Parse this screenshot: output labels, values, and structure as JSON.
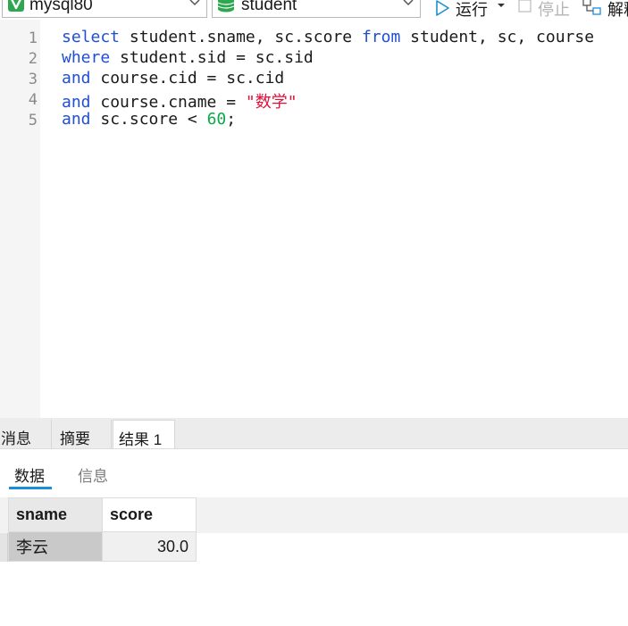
{
  "toolbar": {
    "connection": "mysql80",
    "database": "student",
    "run_label": "运行",
    "stop_label": "停止",
    "explain_label": "解释",
    "icons": [
      "connection-icon",
      "database-icon",
      "run-icon",
      "stop-icon",
      "explain-icon",
      "chevron-down-icon"
    ]
  },
  "editor": {
    "line_numbers": [
      "1",
      "2",
      "3",
      "4",
      "5"
    ],
    "lines": [
      [
        {
          "t": "select",
          "k": "kw"
        },
        {
          "t": " student.sname, sc.score ",
          "k": ""
        },
        {
          "t": "from",
          "k": "kw"
        },
        {
          "t": " student, sc, course",
          "k": ""
        }
      ],
      [
        {
          "t": "where",
          "k": "kw"
        },
        {
          "t": " student.sid = sc.sid",
          "k": ""
        }
      ],
      [
        {
          "t": "and",
          "k": "kw"
        },
        {
          "t": " course.cid = sc.cid",
          "k": ""
        }
      ],
      [
        {
          "t": "and",
          "k": "kw"
        },
        {
          "t": " course.cname = ",
          "k": ""
        },
        {
          "t": "\"数学\"",
          "k": "str"
        }
      ],
      [
        {
          "t": "and",
          "k": "kw"
        },
        {
          "t": " sc.score < ",
          "k": ""
        },
        {
          "t": "60",
          "k": "num"
        },
        {
          "t": ";",
          "k": ""
        }
      ]
    ]
  },
  "result_panel": {
    "tabs": [
      "消息",
      "摘要",
      "结果 1"
    ],
    "active_tab": "结果 1",
    "subtabs": [
      "数据",
      "信息"
    ],
    "active_subtab": "数据",
    "columns": [
      "sname",
      "score"
    ],
    "rows": [
      [
        "李云",
        "30.0"
      ]
    ]
  },
  "colors": {
    "keyword": "#1f4fd6",
    "string": "#e0103a",
    "number": "#0aa84a",
    "accent": "#1a8fd8"
  }
}
